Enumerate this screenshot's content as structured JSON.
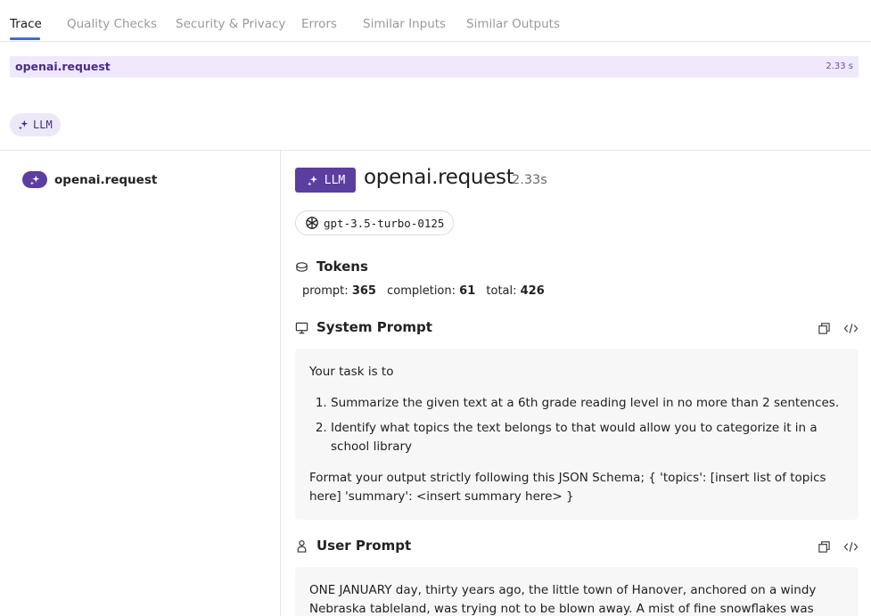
{
  "tabs": [
    {
      "label": "Trace",
      "active": true
    },
    {
      "label": "Quality Checks",
      "active": false
    },
    {
      "label": "Security & Privacy",
      "active": false
    },
    {
      "label": "Errors",
      "active": false
    },
    {
      "label": "Similar Inputs",
      "active": false
    },
    {
      "label": "Similar Outputs",
      "active": false
    }
  ],
  "timeline": {
    "span_name": "openai.request",
    "duration": "2.33 s"
  },
  "filter_chip": {
    "label": "LLM"
  },
  "sidebar": {
    "items": [
      {
        "label": "openai.request"
      }
    ]
  },
  "detail": {
    "badge": "LLM",
    "title": "openai.request",
    "duration": "2.33s",
    "model": "gpt-3.5-turbo-0125",
    "tokens": {
      "heading": "Tokens",
      "prompt_label": "prompt:",
      "prompt": "365",
      "completion_label": "completion:",
      "completion": "61",
      "total_label": "total:",
      "total": "426"
    },
    "system_prompt": {
      "heading": "System Prompt",
      "intro": "Your task is to",
      "items": [
        "Summarize the given text at a 6th grade reading level in no more than 2 sentences.",
        "Identify what topics the text belongs to that would allow you to categorize it in a school library"
      ],
      "outro": "Format your output strictly following this JSON Schema; { 'topics': [insert list of topics here] 'summary': <insert summary here> }"
    },
    "user_prompt": {
      "heading": "User Prompt",
      "text": "ONE JANUARY day, thirty years ago, the little town of Hanover, anchored on a windy Nebraska tableland, was trying not to be blown away. A mist of fine snowflakes was curling"
    }
  },
  "colors": {
    "accent": "#5b3e9e",
    "tab_underline": "#3b6fd1",
    "span_bar": "#efe9fb"
  }
}
